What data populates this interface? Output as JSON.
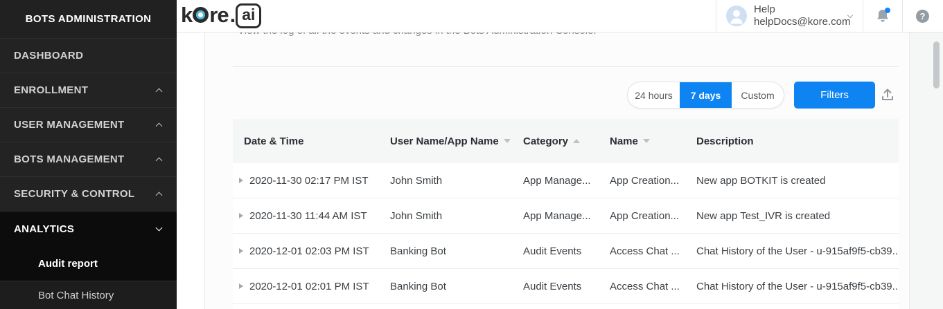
{
  "sidebar": {
    "title": "BOTS ADMINISTRATION",
    "items": [
      {
        "label": "DASHBOARD",
        "chevron": "none",
        "active": false
      },
      {
        "label": "ENROLLMENT",
        "chevron": "up",
        "active": false
      },
      {
        "label": "USER MANAGEMENT",
        "chevron": "up",
        "active": false
      },
      {
        "label": "BOTS MANAGEMENT",
        "chevron": "up",
        "active": false
      },
      {
        "label": "SECURITY & CONTROL",
        "chevron": "up",
        "active": false
      },
      {
        "label": "ANALYTICS",
        "chevron": "down",
        "active": true
      }
    ],
    "sub_items": [
      {
        "label": "Audit report",
        "active": true
      },
      {
        "label": "Bot Chat History",
        "active": false
      }
    ]
  },
  "topbar": {
    "logo": {
      "part1": "k",
      "part2": "re",
      "dot": ".",
      "suffix": "ai"
    },
    "user": {
      "name": "Help",
      "email": "helpDocs@kore.com"
    },
    "icons": {
      "help_glyph": "?"
    }
  },
  "page": {
    "subtitle": "View the log of all the events and changes in the Bots Administration Console."
  },
  "controls": {
    "ranges": [
      "24 hours",
      "7 days",
      "Custom"
    ],
    "selected_range": "7 days",
    "filters_label": "Filters"
  },
  "table": {
    "columns": [
      {
        "label": "Date & Time",
        "sort": "none"
      },
      {
        "label": "User Name/App Name",
        "sort": "down"
      },
      {
        "label": "Category",
        "sort": "up"
      },
      {
        "label": "Name",
        "sort": "down"
      },
      {
        "label": "Description",
        "sort": "none"
      }
    ],
    "rows": [
      {
        "datetime": "2020-11-30 02:17 PM IST",
        "user": "John Smith",
        "category": "App Manage...",
        "name": "App Creation...",
        "description": "New app BOTKIT is created"
      },
      {
        "datetime": "2020-11-30 11:44 AM IST",
        "user": "John Smith",
        "category": "App Manage...",
        "name": "App Creation...",
        "description": "New app Test_IVR is created"
      },
      {
        "datetime": "2020-12-01 02:03 PM IST",
        "user": "Banking Bot",
        "category": "Audit Events",
        "name": "Access Chat ...",
        "description": "Chat History of the User - u-915af9f5-cb39..."
      },
      {
        "datetime": "2020-12-01 02:01 PM IST",
        "user": "Banking Bot",
        "category": "Audit Events",
        "name": "Access Chat ...",
        "description": "Chat History of the User - u-915af9f5-cb39..."
      }
    ]
  },
  "colors": {
    "accent_blue": "#0d84f2",
    "logo_teal": "#49b9da",
    "sidebar_bg": "#232323",
    "sidebar_active_bg": "#0c0c0c",
    "notification_dot": "#1486f7",
    "table_header_bg": "#f5f6f6"
  }
}
